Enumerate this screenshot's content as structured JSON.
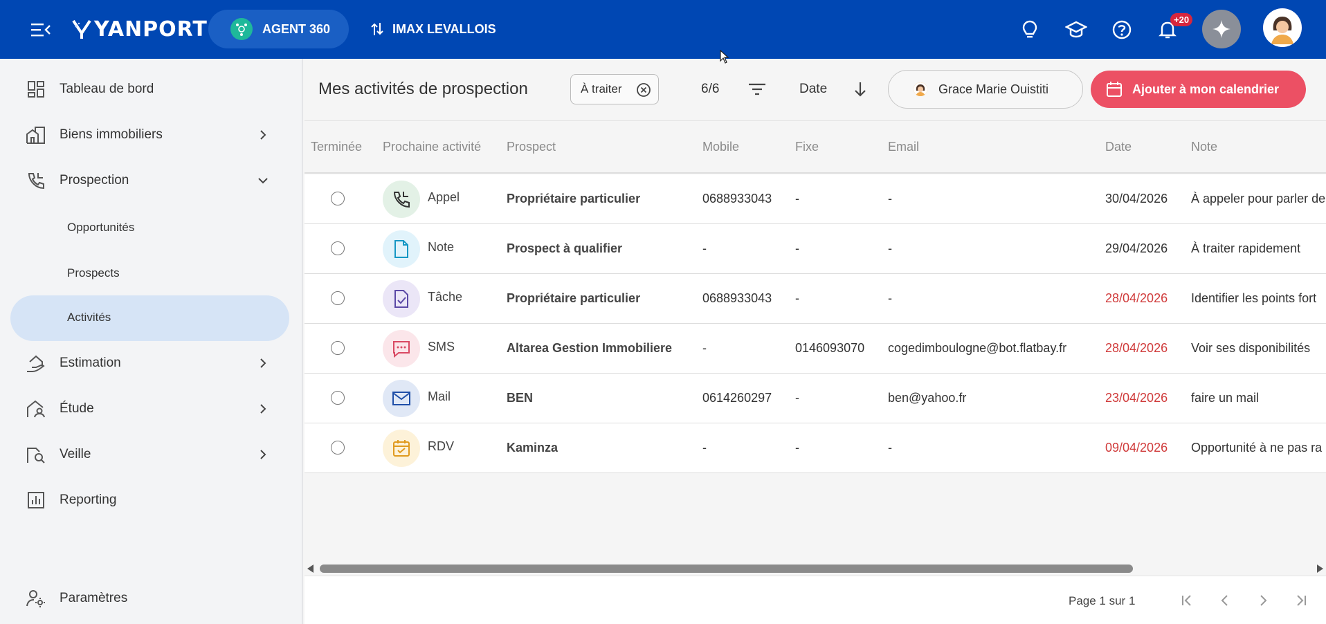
{
  "topbar": {
    "brand": "YANPORT",
    "agent_label": "AGENT 360",
    "agency_label": "IMAX LEVALLOIS",
    "notif_badge": "+20",
    "colors": {
      "bar": "#0047b3",
      "agent_icon": "#1fb89a",
      "badge": "#d7263d"
    },
    "icons": [
      "menu-icon",
      "lightbulb-icon",
      "graduation-cap-icon",
      "help-icon",
      "bell-icon",
      "sparkle-icon",
      "avatar"
    ]
  },
  "sidebar": {
    "items": [
      {
        "label": "Tableau de bord",
        "icon": "dashboard-icon"
      },
      {
        "label": "Biens immobiliers",
        "icon": "buildings-icon"
      },
      {
        "label": "Prospection",
        "icon": "phone-icon"
      },
      {
        "label": "Estimation",
        "icon": "house-hand-icon"
      },
      {
        "label": "Étude",
        "icon": "house-user-icon"
      },
      {
        "label": "Veille",
        "icon": "house-search-icon"
      },
      {
        "label": "Reporting",
        "icon": "chart-icon"
      }
    ],
    "sub_items": [
      {
        "label": "Opportunités"
      },
      {
        "label": "Prospects"
      },
      {
        "label": "Activités",
        "active": true
      }
    ],
    "settings_label": "Paramètres"
  },
  "header": {
    "title": "Mes activités de prospection",
    "chip_label": "À traiter",
    "count": "6/6",
    "sort_label": "Date",
    "user_label": "Grace Marie Ouistiti",
    "calendar_label": "Ajouter à mon calendrier",
    "colors": {
      "calendar_button": "#ec5064"
    }
  },
  "table": {
    "columns": [
      "Terminée",
      "Prochaine activité",
      "Prospect",
      "Mobile",
      "Fixe",
      "Email",
      "Date",
      "Note"
    ],
    "rows": [
      {
        "type": "Appel",
        "prospect": "Propriétaire particulier",
        "mobile": "0688933043",
        "fixe": "-",
        "email": "-",
        "date": "30/04/2026",
        "note": "À appeler pour parler de",
        "late": false
      },
      {
        "type": "Note",
        "prospect": "Prospect à qualifier",
        "mobile": "-",
        "fixe": "-",
        "email": "-",
        "date": "29/04/2026",
        "note": "À traiter rapidement",
        "late": false
      },
      {
        "type": "Tâche",
        "prospect": "Propriétaire particulier",
        "mobile": "0688933043",
        "fixe": "-",
        "email": "-",
        "date": "28/04/2026",
        "note": "Identifier les points fort",
        "late": true
      },
      {
        "type": "SMS",
        "prospect": "Altarea Gestion Immobiliere",
        "mobile": "-",
        "fixe": "0146093070",
        "email": "cogedimboulogne@bot.flatbay.fr",
        "date": "28/04/2026",
        "note": "Voir ses disponibilités",
        "late": true
      },
      {
        "type": "Mail",
        "prospect": "BEN",
        "mobile": "0614260297",
        "fixe": "-",
        "email": "ben@yahoo.fr",
        "date": "23/04/2026",
        "note": "faire un mail",
        "late": true
      },
      {
        "type": "RDV",
        "prospect": "Kaminza",
        "mobile": "-",
        "fixe": "-",
        "email": "-",
        "date": "09/04/2026",
        "note": "Opportunité à ne pas ra",
        "late": true
      }
    ]
  },
  "pagination": {
    "info": "Page 1 sur 1"
  }
}
